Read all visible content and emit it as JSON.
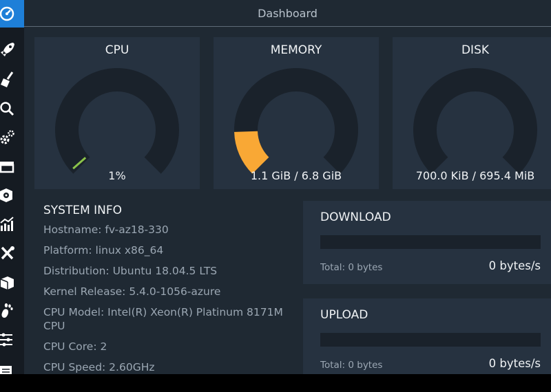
{
  "header": {
    "title": "Dashboard"
  },
  "sidebar": {
    "items": [
      {
        "icon": "dashboard-gauge-icon",
        "active": true
      },
      {
        "icon": "rocket-icon"
      },
      {
        "icon": "broom-icon"
      },
      {
        "icon": "search-icon"
      },
      {
        "icon": "gears-icon"
      },
      {
        "icon": "archive-box-icon"
      },
      {
        "icon": "disk-package-icon"
      },
      {
        "icon": "chart-icon"
      },
      {
        "icon": "tools-icon"
      },
      {
        "icon": "package-icon"
      },
      {
        "icon": "gnome-foot-icon"
      },
      {
        "icon": "sliders-icon"
      },
      {
        "icon": "list-icon"
      }
    ]
  },
  "gauges": [
    {
      "label": "CPU",
      "value": "1%",
      "fraction": 0.01,
      "color": "#8bc34a"
    },
    {
      "label": "MEMORY",
      "value": "1.1 GiB / 6.8 GiB",
      "fraction": 0.16,
      "color": "#f9a835"
    },
    {
      "label": "DISK",
      "value": "700.0 KiB / 695.4 MiB",
      "fraction": 0.0,
      "color": "#f9a835"
    }
  ],
  "system_info": {
    "heading": "SYSTEM INFO",
    "hostname": "Hostname: fv-az18-330",
    "platform": "Platform: linux x86_64",
    "distribution": "Distribution: Ubuntu 18.04.5 LTS",
    "kernel": "Kernel Release: 5.4.0-1056-azure",
    "cpu_model": "CPU Model: Intel(R) Xeon(R) Platinum 8171M CPU",
    "cpu_core": "CPU Core: 2",
    "cpu_speed": "CPU Speed: 2.60GHz"
  },
  "download": {
    "heading": "DOWNLOAD",
    "total": "Total: 0 bytes",
    "rate": "0 bytes/s",
    "progress": 0
  },
  "upload": {
    "heading": "UPLOAD",
    "total": "Total: 0 bytes",
    "rate": "0 bytes/s",
    "progress": 0
  },
  "colors": {
    "accent": "#1e7fd8",
    "panel": "#263240",
    "background": "#1f2933",
    "gauge_track": "#1a222b"
  }
}
